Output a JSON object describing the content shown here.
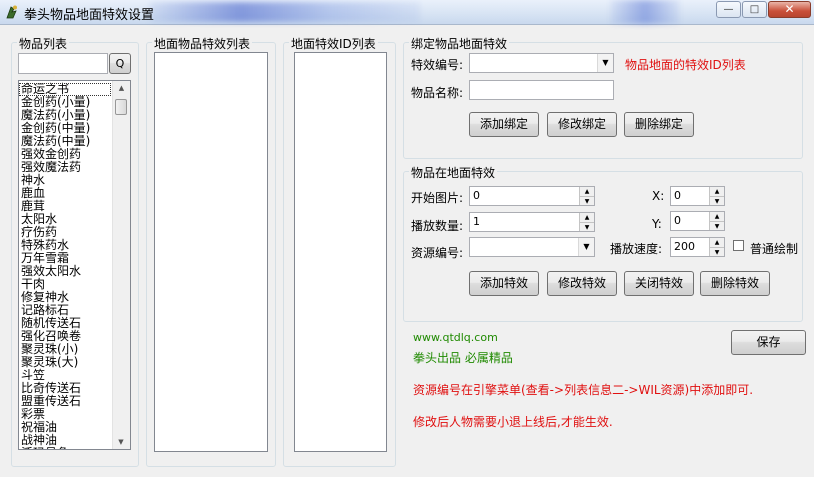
{
  "window": {
    "title": "拳头物品地面特效设置",
    "min_glyph": "—",
    "max_glyph": "□",
    "close_glyph": "✕"
  },
  "item_list": {
    "label": "物品列表",
    "search_value": "",
    "search_button": "Q",
    "items": [
      "命运之书",
      "金创药(小量)",
      "魔法药(小量)",
      "金创药(中量)",
      "魔法药(中量)",
      "强效金创药",
      "强效魔法药",
      "神水",
      "鹿血",
      "鹿茸",
      "太阳水",
      "疗伤药",
      "特殊药水",
      "万年雪霜",
      "强效太阳水",
      "干肉",
      "修复神水",
      "记路标石",
      "随机传送石",
      "强化召唤卷",
      "聚灵珠(小)",
      "聚灵珠(大)",
      "斗笠",
      "比奇传送石",
      "盟重传送石",
      "彩票",
      "祝福油",
      "战神油",
      "沃玛号角"
    ]
  },
  "ground_effect_list": {
    "label": "地面物品特效列表",
    "items": []
  },
  "effect_id_list": {
    "label": "地面特效ID列表",
    "items": []
  },
  "bind_group": {
    "label": "绑定物品地面特效",
    "effect_no_label": "特效编号:",
    "effect_no_value": "",
    "hint": "物品地面的特效ID列表",
    "item_name_label": "物品名称:",
    "item_name_value": "",
    "add_button": "添加绑定",
    "modify_button": "修改绑定",
    "delete_button": "删除绑定"
  },
  "effect_group": {
    "label": "物品在地面特效",
    "start_image_label": "开始图片:",
    "start_image_value": "0",
    "play_count_label": "播放数量:",
    "play_count_value": "1",
    "resource_no_label": "资源编号:",
    "resource_no_value": "",
    "x_label": "X:",
    "x_value": "0",
    "y_label": "Y:",
    "y_value": "0",
    "speed_label": "播放速度:",
    "speed_value": "200",
    "normal_draw_label": "普通绘制",
    "normal_draw_checked": false,
    "add_button": "添加特效",
    "modify_button": "修改特效",
    "close_button": "关闭特效",
    "delete_button": "删除特效"
  },
  "footer": {
    "website": "www.qtdlq.com",
    "slogan": "拳头出品 必属精品",
    "save_button": "保存",
    "note1": "资源编号在引擎菜单(查看->列表信息二->WIL资源)中添加即可.",
    "note2": "修改后人物需要小退上线后,才能生效."
  },
  "colors": {
    "hint_red": "#e01010",
    "website_green": "#1f8a00"
  }
}
